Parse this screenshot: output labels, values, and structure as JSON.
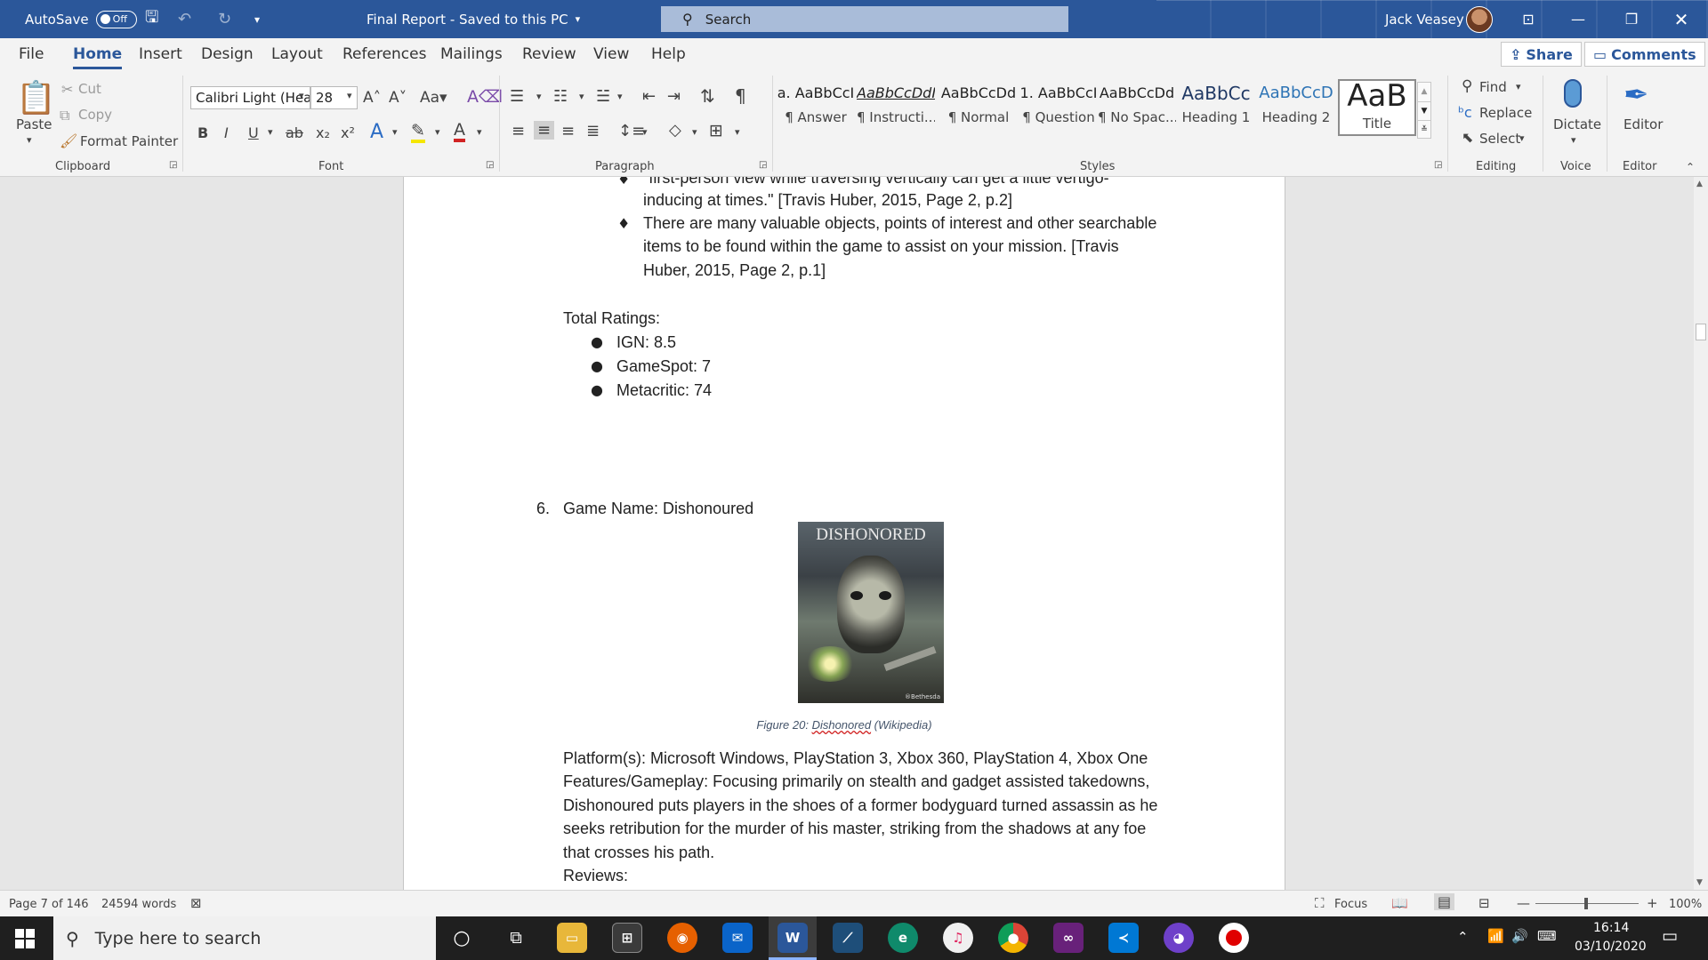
{
  "titlebar": {
    "autosave_label": "AutoSave",
    "autosave_state": "Off",
    "doc_title": "Final Report  -  Saved to this PC",
    "search_placeholder": "Search",
    "user_name": "Jack Veasey"
  },
  "tabs": [
    "File",
    "Home",
    "Insert",
    "Design",
    "Layout",
    "References",
    "Mailings",
    "Review",
    "View",
    "Help"
  ],
  "share_label": "Share",
  "comments_label": "Comments",
  "clipboard": {
    "paste": "Paste",
    "cut": "Cut",
    "copy": "Copy",
    "format_painter": "Format Painter",
    "label": "Clipboard"
  },
  "font": {
    "name": "Calibri Light (Hea",
    "size": "28",
    "label": "Font"
  },
  "paragraph": {
    "label": "Paragraph"
  },
  "styles": {
    "label": "Styles",
    "items": [
      {
        "preview": "a. AaBbCcI",
        "name": "¶ Answer"
      },
      {
        "preview": "AaBbCcDdI",
        "name": "¶ Instructi..."
      },
      {
        "preview": "AaBbCcDd",
        "name": "¶ Normal"
      },
      {
        "preview": "1. AaBbCcI",
        "name": "¶ Question"
      },
      {
        "preview": "AaBbCcDd",
        "name": "¶ No Spac..."
      },
      {
        "preview": "AaBbCc",
        "name": "Heading 1"
      },
      {
        "preview": "AaBbCcD",
        "name": "Heading 2"
      },
      {
        "preview": "AaB",
        "name": "Title"
      }
    ]
  },
  "editing": {
    "find": "Find",
    "replace": "Replace",
    "select": "Select",
    "label": "Editing"
  },
  "voice": {
    "dictate": "Dictate",
    "label": "Voice"
  },
  "editor": {
    "editor": "Editor",
    "label": "Editor"
  },
  "document": {
    "line_cut": "\"first-person view while traversing vertically can get a little vertigo-",
    "line_cut2": "inducing at times.\" [Travis Huber, 2015, Page 2, p.2]",
    "bullet2_l1": "There are many valuable objects, points of interest and other searchable",
    "bullet2_l2": "items to be found within the game to assist on your mission. [Travis",
    "bullet2_l3": "Huber, 2015, Page 2, p.1]",
    "total_ratings": "Total Ratings:",
    "ratings": [
      "IGN: 8.5",
      "GameSpot: 7",
      "Metacritic: 74"
    ],
    "item_number": "6.",
    "game_name": "Game Name: Dishonoured",
    "cover_title": "DISHONORED",
    "cover_publisher": "Bethesda",
    "caption_prefix": "Figure 20: ",
    "caption_misspelled": "Dishonored",
    "caption_suffix": " (Wikipedia)",
    "para_lines": [
      "Platform(s): Microsoft Windows, PlayStation 3, Xbox 360, PlayStation 4, Xbox One",
      "Features/Gameplay: Focusing primarily on stealth and gadget assisted takedowns,",
      "Dishonoured puts players in the shoes of a former bodyguard turned assassin as he",
      "seeks retribution for the murder of his master, striking from the shadows at any foe",
      "that crosses his path.",
      "Reviews:"
    ]
  },
  "status": {
    "page": "Page 7 of 146",
    "words": "24594 words",
    "focus": "Focus",
    "zoom": "100%"
  },
  "taskbar": {
    "search_placeholder": "Type here to search",
    "time": "16:14",
    "date": "03/10/2020"
  }
}
